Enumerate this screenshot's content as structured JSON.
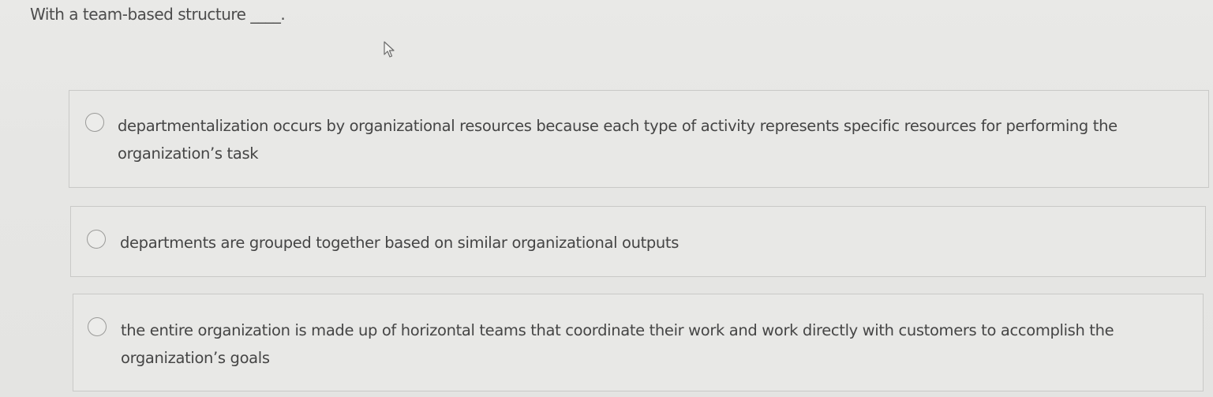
{
  "question": {
    "text": "With a team-based structure ____."
  },
  "options": [
    {
      "label": "departmentalization occurs by organizational resources because each type of activity represents specific resources for performing the organization’s task",
      "selected": false
    },
    {
      "label": "departments are grouped together based on similar organizational outputs",
      "selected": false
    },
    {
      "label": "the entire organization is made up of horizontal teams that coordinate their work and work directly with customers to accomplish the organization’s goals",
      "selected": false
    }
  ]
}
